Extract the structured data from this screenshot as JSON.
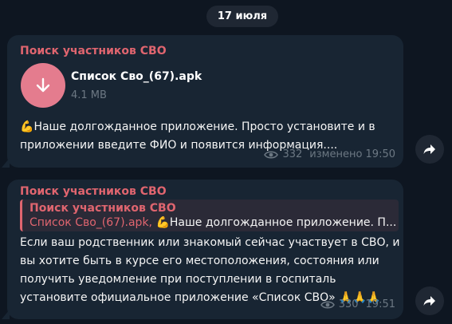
{
  "date_pill": "17 июля",
  "colors": {
    "background": "#0e1621",
    "bubble": "#182533",
    "sender": "#e0656f",
    "file_icon_bg": "#e47c8e",
    "meta": "#6c7883"
  },
  "message1": {
    "sender": "Поиск участников СВО",
    "file": {
      "icon": "download-arrow-icon",
      "name": "Список Сво_(67).apk",
      "size": "4.1 MB"
    },
    "text_line1": "Наше долгожданное приложение. Просто установите и в",
    "text_line2": "приложении введите ФИО и появится информация....",
    "views": "332",
    "edited": "изменено 19:50"
  },
  "message2": {
    "sender": "Поиск участников СВО",
    "reply": {
      "title": "Поиск участников СВО",
      "file_name": "Список Сво_(67).apk,",
      "text": "Наше долгожданное приложение. П..."
    },
    "text_line1": "Если ваш родственник или знакомый сейчас участвует в СВО, и",
    "text_line2": "вы хотите быть в курсе его местоположения, состояния или",
    "text_line3": "получить уведомление при поступлении в госпиталь",
    "text_line4": "установите официальное приложение «Список СВО»",
    "views": "330",
    "time": "19:51"
  },
  "icons": {
    "forward": "forward-arrow-icon",
    "views": "eye-icon",
    "muscle": "flexed-biceps-emoji",
    "pray": "folded-hands-emoji"
  }
}
